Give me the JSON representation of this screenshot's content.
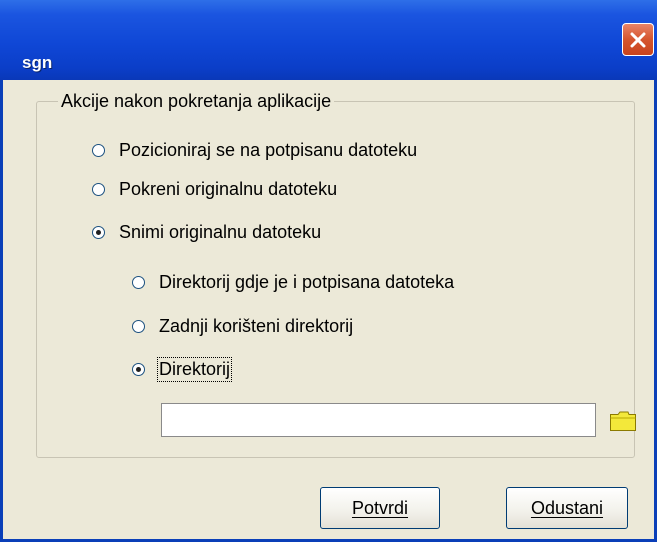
{
  "window": {
    "title": "sgn"
  },
  "group": {
    "legend": "Akcije nakon pokretanja aplikacije",
    "options": [
      {
        "label": "Pozicioniraj se na potpisanu datoteku",
        "checked": false
      },
      {
        "label": "Pokreni originalnu datoteku",
        "checked": false
      },
      {
        "label": "Snimi originalnu datoteku",
        "checked": true
      }
    ],
    "sub_options": [
      {
        "label": "Direktorij gdje je i potpisana datoteka",
        "checked": false
      },
      {
        "label": "Zadnji korišteni direktorij",
        "checked": false
      },
      {
        "label": "Direktorij",
        "checked": true
      }
    ],
    "directory_value": ""
  },
  "buttons": {
    "ok": "Potvrdi",
    "cancel": "Odustani"
  },
  "icons": {
    "close": "close-icon",
    "folder": "folder-icon"
  },
  "colors": {
    "title_bar": "#0f47d6",
    "dialog_bg": "#ece9d8",
    "close_button": "#d5552e"
  }
}
